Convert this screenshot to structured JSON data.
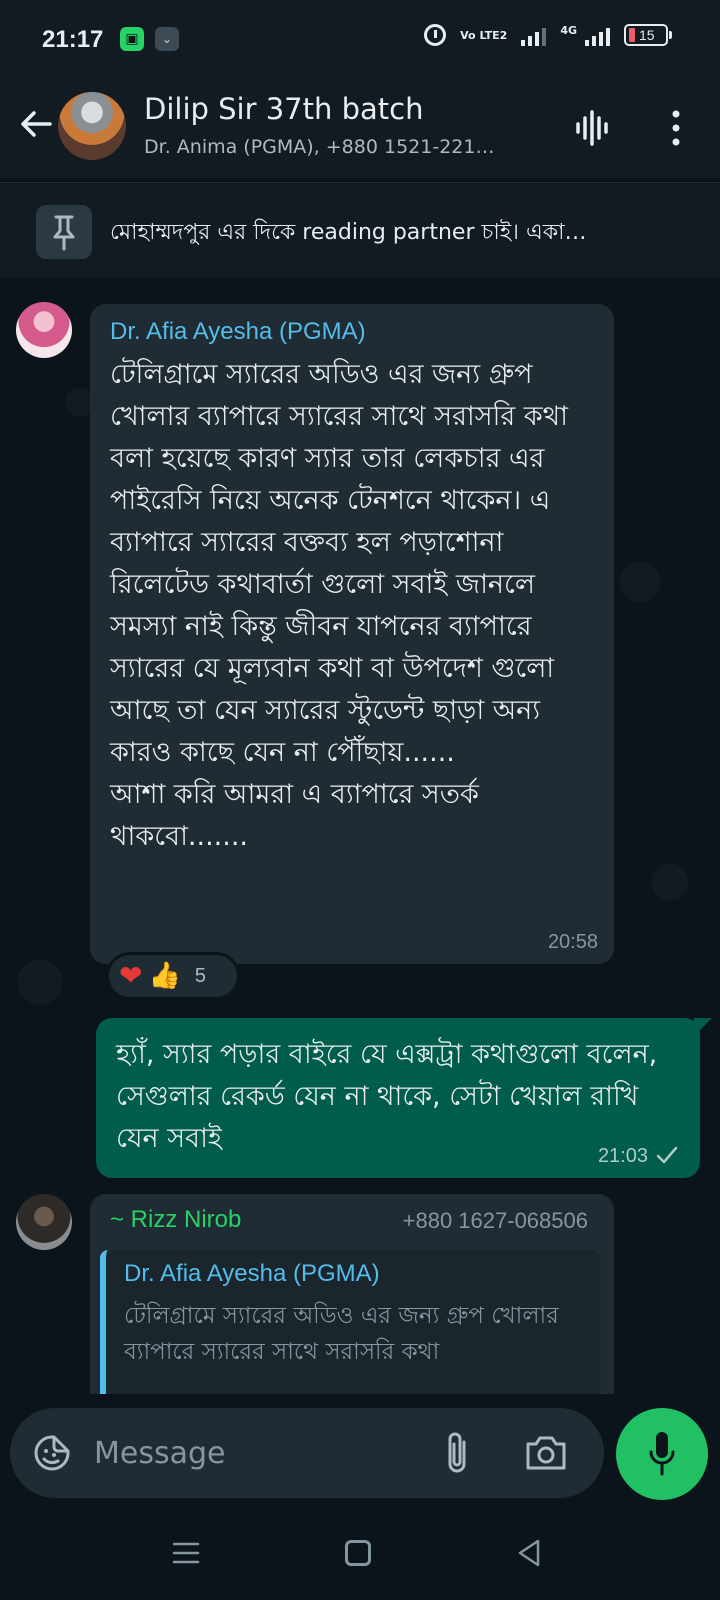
{
  "status_bar": {
    "time": "21:17",
    "network_label": "Vo LTE2",
    "network_type": "4G",
    "battery": "15"
  },
  "header": {
    "title": "Dilip Sir 37th batch",
    "subtitle": "Dr. Anima (PGMA), +880 1521-221…",
    "icons": [
      "back-arrow-icon",
      "voice-chat-icon",
      "more-vertical-icon"
    ]
  },
  "pinned": {
    "text": "মোহাম্মদপুর এর দিকে  reading partner চাই। একা…"
  },
  "messages": [
    {
      "direction": "incoming",
      "sender": "Dr. Afia Ayesha (PGMA)",
      "body": "টেলিগ্রামে স্যারের অডিও এর জন্য গ্রুপ খোলার ব্যাপারে স্যারের সাথে সরাসরি কথা বলা হয়েছে কারণ স্যার তার লেকচার এর পাইরেসি নিয়ে অনেক টেনশনে থাকেন। এ ব্যাপারে স্যারের বক্তব্য হল পড়াশোনা রিলেটেড কথাবার্তা গুলো সবাই জানলে সমস্যা নাই কিন্তু জীবন যাপনের ব্যাপারে স্যারের যে মূল্যবান কথা বা উপদেশ গুলো আছে তা যেন স্যারের স্টুডেন্ট ছাড়া অন্য কারও কাছে যেন না পৌঁছায়......\nআশা করি আমরা এ ব্যাপারে সতর্ক থাকবো.......",
      "time": "20:58",
      "reactions": {
        "emojis": [
          "❤",
          "👍"
        ],
        "count": "5"
      }
    },
    {
      "direction": "outgoing",
      "body": "হ্যাঁ,  স্যার পড়ার বাইরে যে এক্সট্রা কথাগুলো বলেন, সেগুলার রেকর্ড যেন না থাকে, সেটা খেয়াল রাখি যেন সবাই",
      "time": "21:03",
      "status": "sent"
    },
    {
      "direction": "incoming",
      "sender": "~ Rizz Nirob",
      "phone": "+880 1627-068506",
      "quote": {
        "sender": "Dr. Afia Ayesha (PGMA)",
        "body": "টেলিগ্রামে স্যারের অডিও এর জন্য গ্রুপ খোলার ব্যাপারে স্যারের সাথে সরাসরি কথা"
      }
    }
  ],
  "composer": {
    "placeholder": "Message"
  },
  "colors": {
    "background": "#0b141a",
    "header": "#111b21",
    "incoming_bubble": "#202c33",
    "outgoing_bubble": "#005c4b",
    "accent_green": "#21c063",
    "sender_blue": "#53bdeb",
    "sender_green": "#25d366"
  }
}
